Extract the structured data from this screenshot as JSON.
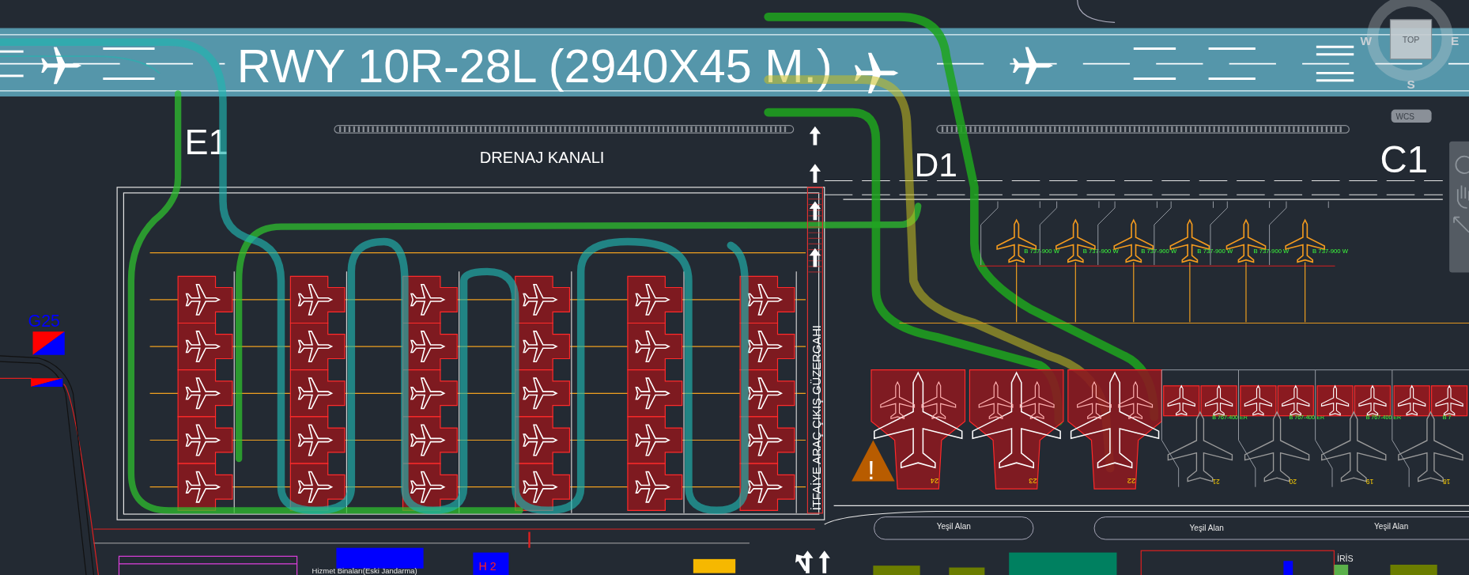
{
  "runway": {
    "label": "RWY 10R-28L (2940X45 M.)"
  },
  "taxiways": [
    {
      "label": "E1"
    },
    {
      "label": "D1"
    },
    {
      "label": "C1"
    }
  ],
  "drainage_label": "DRENAJ KANALI",
  "fire_route_label": "İTFAİYE ARAÇ ÇIKIŞ GÜZERGAHI",
  "gate_marker": {
    "label": "G25"
  },
  "warning_sign": "!",
  "narrow_stands": [
    {
      "aircraft": "B 737-900 W"
    },
    {
      "aircraft": "B 737-900 W"
    },
    {
      "aircraft": "B 737-900 W"
    },
    {
      "aircraft": "B 737-900 W"
    },
    {
      "aircraft": "B 737-900 W"
    },
    {
      "aircraft": "B 737-900 W"
    }
  ],
  "large_stands": [
    {
      "number": "24"
    },
    {
      "number": "23"
    },
    {
      "number": "22"
    }
  ],
  "wide_stands": [
    {
      "number": "21",
      "aircraft": "B 767-400 ER"
    },
    {
      "number": "20",
      "aircraft": "B 767-400 ER"
    },
    {
      "number": "19",
      "aircraft": "B 767-400 ER"
    },
    {
      "number": "18",
      "aircraft": "B 7"
    }
  ],
  "green_areas": [
    "Yeşil Alan",
    "Yeşil Alan",
    "Yeşil Alan"
  ],
  "building_label": "Hizmet Binaları(Eski Jandarma)",
  "heliport_label": "H 2",
  "iris_label": "İRİS",
  "view_cube": {
    "face": "TOP",
    "west": "W",
    "east": "E",
    "south": "S"
  },
  "coordinate_system": "WCS"
}
